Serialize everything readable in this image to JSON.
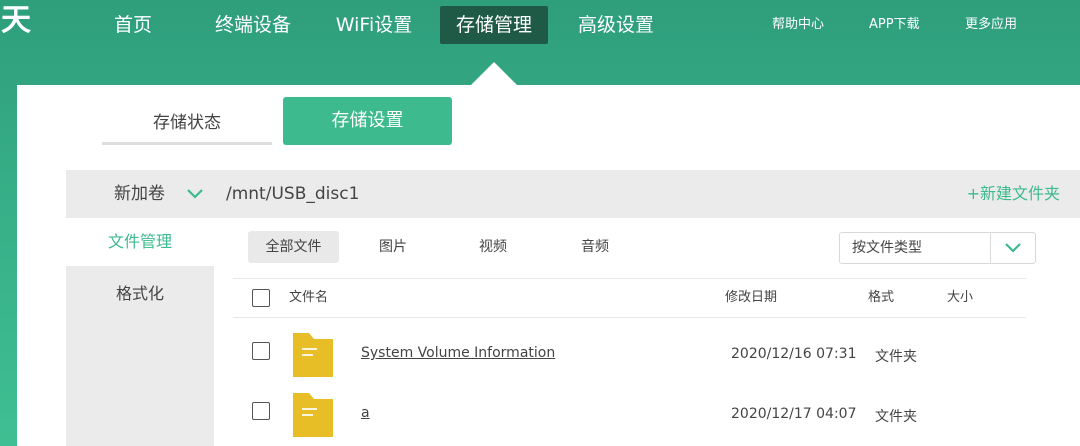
{
  "logo": {
    "text": "天"
  },
  "nav": {
    "items": [
      {
        "label": "首页"
      },
      {
        "label": "终端设备"
      },
      {
        "label": "WiFi设置"
      },
      {
        "label": "存储管理"
      },
      {
        "label": "高级设置"
      }
    ],
    "links": [
      {
        "label": "帮助中心"
      },
      {
        "label": "APP下载"
      },
      {
        "label": "更多应用"
      }
    ]
  },
  "subtabs": {
    "status": "存储状态",
    "settings": "存储设置"
  },
  "volume": {
    "name": "新加卷",
    "path": "/mnt/USB_disc1",
    "new_folder": "+新建文件夹"
  },
  "sidebar": {
    "items": [
      {
        "label": "文件管理"
      },
      {
        "label": "格式化"
      }
    ]
  },
  "filters": [
    {
      "label": "全部文件"
    },
    {
      "label": "图片"
    },
    {
      "label": "视频"
    },
    {
      "label": "音频"
    }
  ],
  "sort": {
    "selected": "按文件类型"
  },
  "table": {
    "headers": {
      "name": "文件名",
      "date": "修改日期",
      "format": "格式",
      "size": "大小"
    },
    "rows": [
      {
        "name": "System Volume Information",
        "date": "2020/12/16 07:31",
        "format": "文件夹",
        "size": ""
      },
      {
        "name": "a",
        "date": "2020/12/17 04:07",
        "format": "文件夹",
        "size": ""
      }
    ]
  },
  "colors": {
    "accent": "#3dba8e",
    "nav_active": "#1f5a47",
    "folder": "#e8be27",
    "header_gradient_top": "#2f9e7b"
  }
}
